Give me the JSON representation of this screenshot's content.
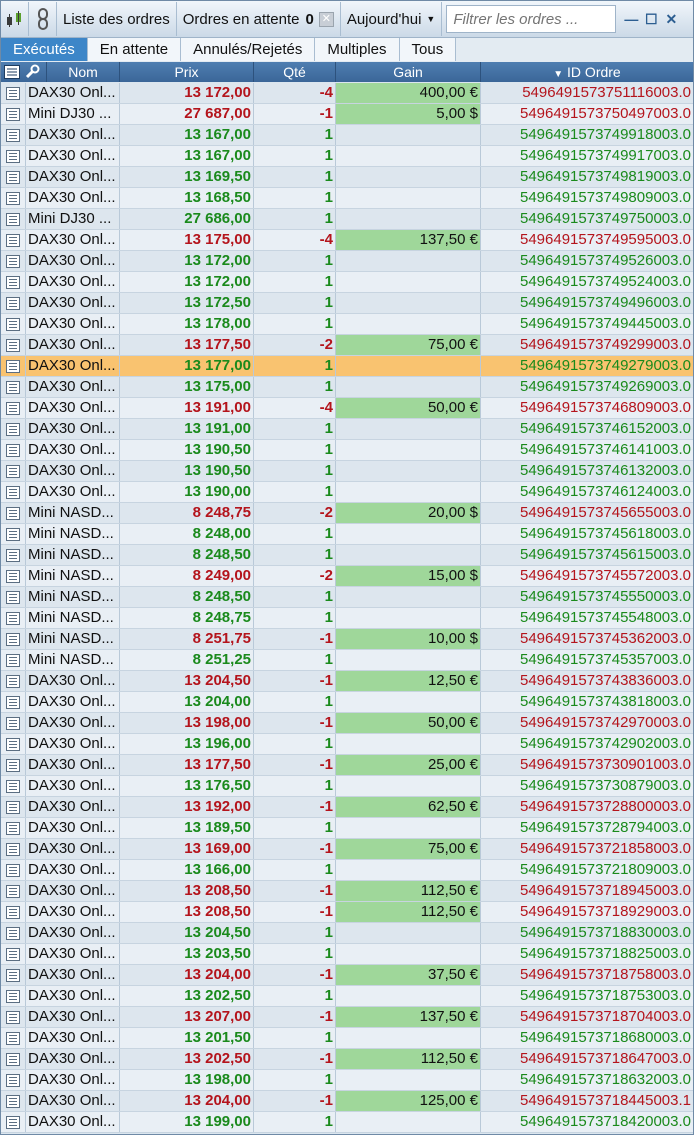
{
  "toolbar": {
    "orders_list_label": "Liste des ordres",
    "pending_label": "Ordres en attente",
    "pending_count": "0",
    "date_filter_label": "Aujourd'hui",
    "filter_placeholder": "Filtrer les ordres ..."
  },
  "tabs": [
    "Exécutés",
    "En attente",
    "Annulés/Rejetés",
    "Multiples",
    "Tous"
  ],
  "columns": {
    "name": "Nom",
    "price": "Prix",
    "qty": "Qté",
    "gain": "Gain",
    "id": "ID Ordre"
  },
  "colors": {
    "sell": "#b4141c",
    "buy": "#1a8a1c",
    "gain_bg": "#9fd79a",
    "selected_row": "#f9c370"
  },
  "rows": [
    {
      "name": "DAX30 Onl...",
      "price": "13 172,00",
      "qty": "-4",
      "gain": "400,00 €",
      "id": "549649157375111600 3.0"
    },
    {
      "name": "Mini DJ30 ...",
      "price": "27 687,00",
      "qty": "-1",
      "gain": "5,00 $",
      "id": "5496491573750497003.0"
    },
    {
      "name": "DAX30 Onl...",
      "price": "13 167,00",
      "qty": "1",
      "gain": "",
      "id": "5496491573749918003.0"
    },
    {
      "name": "DAX30 Onl...",
      "price": "13 167,00",
      "qty": "1",
      "gain": "",
      "id": "5496491573749917003.0"
    },
    {
      "name": "DAX30 Onl...",
      "price": "13 169,50",
      "qty": "1",
      "gain": "",
      "id": "5496491573749819003.0"
    },
    {
      "name": "DAX30 Onl...",
      "price": "13 168,50",
      "qty": "1",
      "gain": "",
      "id": "5496491573749809003.0"
    },
    {
      "name": "Mini DJ30 ...",
      "price": "27 686,00",
      "qty": "1",
      "gain": "",
      "id": "5496491573749750003.0"
    },
    {
      "name": "DAX30 Onl...",
      "price": "13 175,00",
      "qty": "-4",
      "gain": "137,50 €",
      "id": "5496491573749595003.0"
    },
    {
      "name": "DAX30 Onl...",
      "price": "13 172,00",
      "qty": "1",
      "gain": "",
      "id": "5496491573749526003.0"
    },
    {
      "name": "DAX30 Onl...",
      "price": "13 172,00",
      "qty": "1",
      "gain": "",
      "id": "5496491573749524003.0"
    },
    {
      "name": "DAX30 Onl...",
      "price": "13 172,50",
      "qty": "1",
      "gain": "",
      "id": "5496491573749496003.0"
    },
    {
      "name": "DAX30 Onl...",
      "price": "13 178,00",
      "qty": "1",
      "gain": "",
      "id": "5496491573749445003.0"
    },
    {
      "name": "DAX30 Onl...",
      "price": "13 177,50",
      "qty": "-2",
      "gain": "75,00 €",
      "id": "5496491573749299003.0"
    },
    {
      "name": "DAX30 Onl...",
      "price": "13 177,00",
      "qty": "1",
      "gain": "",
      "id": "5496491573749279003.0",
      "selected": true
    },
    {
      "name": "DAX30 Onl...",
      "price": "13 175,00",
      "qty": "1",
      "gain": "",
      "id": "5496491573749269003.0"
    },
    {
      "name": "DAX30 Onl...",
      "price": "13 191,00",
      "qty": "-4",
      "gain": "50,00 €",
      "id": "5496491573746809003.0"
    },
    {
      "name": "DAX30 Onl...",
      "price": "13 191,00",
      "qty": "1",
      "gain": "",
      "id": "5496491573746152003.0"
    },
    {
      "name": "DAX30 Onl...",
      "price": "13 190,50",
      "qty": "1",
      "gain": "",
      "id": "5496491573746141003.0"
    },
    {
      "name": "DAX30 Onl...",
      "price": "13 190,50",
      "qty": "1",
      "gain": "",
      "id": "5496491573746132003.0"
    },
    {
      "name": "DAX30 Onl...",
      "price": "13 190,00",
      "qty": "1",
      "gain": "",
      "id": "5496491573746124003.0"
    },
    {
      "name": "Mini NASD...",
      "price": "8 248,75",
      "qty": "-2",
      "gain": "20,00 $",
      "id": "5496491573745655003.0"
    },
    {
      "name": "Mini NASD...",
      "price": "8 248,00",
      "qty": "1",
      "gain": "",
      "id": "5496491573745618003.0"
    },
    {
      "name": "Mini NASD...",
      "price": "8 248,50",
      "qty": "1",
      "gain": "",
      "id": "5496491573745615003.0"
    },
    {
      "name": "Mini NASD...",
      "price": "8 249,00",
      "qty": "-2",
      "gain": "15,00 $",
      "id": "5496491573745572003.0"
    },
    {
      "name": "Mini NASD...",
      "price": "8 248,50",
      "qty": "1",
      "gain": "",
      "id": "5496491573745550003.0"
    },
    {
      "name": "Mini NASD...",
      "price": "8 248,75",
      "qty": "1",
      "gain": "",
      "id": "5496491573745548003.0"
    },
    {
      "name": "Mini NASD...",
      "price": "8 251,75",
      "qty": "-1",
      "gain": "10,00 $",
      "id": "5496491573745362003.0"
    },
    {
      "name": "Mini NASD...",
      "price": "8 251,25",
      "qty": "1",
      "gain": "",
      "id": "5496491573745357003.0"
    },
    {
      "name": "DAX30 Onl...",
      "price": "13 204,50",
      "qty": "-1",
      "gain": "12,50 €",
      "id": "5496491573743836003.0"
    },
    {
      "name": "DAX30 Onl...",
      "price": "13 204,00",
      "qty": "1",
      "gain": "",
      "id": "5496491573743818003.0"
    },
    {
      "name": "DAX30 Onl...",
      "price": "13 198,00",
      "qty": "-1",
      "gain": "50,00 €",
      "id": "5496491573742970003.0"
    },
    {
      "name": "DAX30 Onl...",
      "price": "13 196,00",
      "qty": "1",
      "gain": "",
      "id": "5496491573742902003.0"
    },
    {
      "name": "DAX30 Onl...",
      "price": "13 177,50",
      "qty": "-1",
      "gain": "25,00 €",
      "id": "5496491573730901003.0"
    },
    {
      "name": "DAX30 Onl...",
      "price": "13 176,50",
      "qty": "1",
      "gain": "",
      "id": "5496491573730879003.0"
    },
    {
      "name": "DAX30 Onl...",
      "price": "13 192,00",
      "qty": "-1",
      "gain": "62,50 €",
      "id": "5496491573728800003.0"
    },
    {
      "name": "DAX30 Onl...",
      "price": "13 189,50",
      "qty": "1",
      "gain": "",
      "id": "5496491573728794003.0"
    },
    {
      "name": "DAX30 Onl...",
      "price": "13 169,00",
      "qty": "-1",
      "gain": "75,00 €",
      "id": "5496491573721858003.0"
    },
    {
      "name": "DAX30 Onl...",
      "price": "13 166,00",
      "qty": "1",
      "gain": "",
      "id": "5496491573721809003.0"
    },
    {
      "name": "DAX30 Onl...",
      "price": "13 208,50",
      "qty": "-1",
      "gain": "112,50 €",
      "id": "5496491573718945003.0"
    },
    {
      "name": "DAX30 Onl...",
      "price": "13 208,50",
      "qty": "-1",
      "gain": "112,50 €",
      "id": "5496491573718929003.0"
    },
    {
      "name": "DAX30 Onl...",
      "price": "13 204,50",
      "qty": "1",
      "gain": "",
      "id": "5496491573718830003.0"
    },
    {
      "name": "DAX30 Onl...",
      "price": "13 203,50",
      "qty": "1",
      "gain": "",
      "id": "5496491573718825003.0"
    },
    {
      "name": "DAX30 Onl...",
      "price": "13 204,00",
      "qty": "-1",
      "gain": "37,50 €",
      "id": "5496491573718758003.0"
    },
    {
      "name": "DAX30 Onl...",
      "price": "13 202,50",
      "qty": "1",
      "gain": "",
      "id": "5496491573718753003.0"
    },
    {
      "name": "DAX30 Onl...",
      "price": "13 207,00",
      "qty": "-1",
      "gain": "137,50 €",
      "id": "5496491573718704003.0"
    },
    {
      "name": "DAX30 Onl...",
      "price": "13 201,50",
      "qty": "1",
      "gain": "",
      "id": "5496491573718680003.0"
    },
    {
      "name": "DAX30 Onl...",
      "price": "13 202,50",
      "qty": "-1",
      "gain": "112,50 €",
      "id": "5496491573718647003.0"
    },
    {
      "name": "DAX30 Onl...",
      "price": "13 198,00",
      "qty": "1",
      "gain": "",
      "id": "5496491573718632003.0"
    },
    {
      "name": "DAX30 Onl...",
      "price": "13 204,00",
      "qty": "-1",
      "gain": "125,00 €",
      "id": "5496491573718445003.1"
    },
    {
      "name": "DAX30 Onl...",
      "price": "13 199,00",
      "qty": "1",
      "gain": "",
      "id": "5496491573718420003.0"
    }
  ]
}
